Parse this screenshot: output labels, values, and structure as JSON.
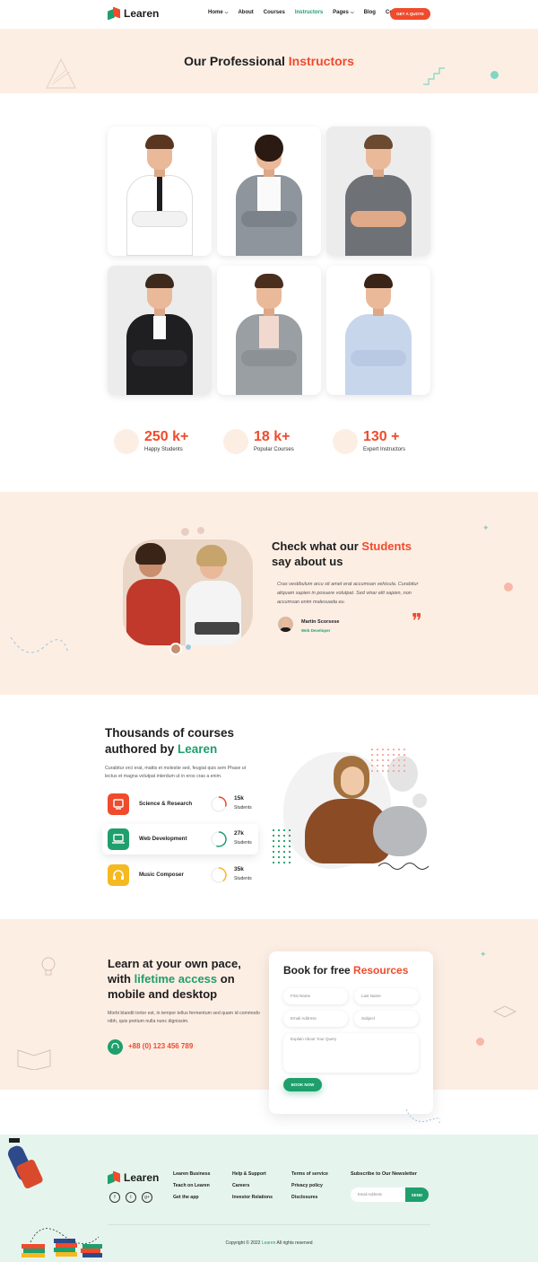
{
  "header": {
    "logo_text": "Learen",
    "nav": [
      {
        "label": "Home",
        "has_dropdown": true,
        "active": false
      },
      {
        "label": "About",
        "has_dropdown": false,
        "active": false
      },
      {
        "label": "Courses",
        "has_dropdown": false,
        "active": false
      },
      {
        "label": "Instructors",
        "has_dropdown": false,
        "active": true
      },
      {
        "label": "Pages",
        "has_dropdown": true,
        "active": false
      },
      {
        "label": "Blog",
        "has_dropdown": false,
        "active": false
      },
      {
        "label": "Contact",
        "has_dropdown": false,
        "active": false
      }
    ],
    "cta_label": "GET A QUOTE"
  },
  "hero": {
    "title_plain": "Our Professional",
    "title_accent": "Instructors"
  },
  "instructors": [
    {
      "name": "instructor-1",
      "icon": "person-photo"
    },
    {
      "name": "instructor-2",
      "icon": "person-photo"
    },
    {
      "name": "instructor-3",
      "icon": "person-photo"
    },
    {
      "name": "instructor-4",
      "icon": "person-photo"
    },
    {
      "name": "instructor-5",
      "icon": "person-photo"
    },
    {
      "name": "instructor-6",
      "icon": "person-photo"
    }
  ],
  "stats": [
    {
      "value": "250 k+",
      "label": "Happy Students",
      "icon": "student-icon"
    },
    {
      "value": "18 k+",
      "label": "Popular Courses",
      "icon": "courses-icon"
    },
    {
      "value": "130 +",
      "label": "Expert Instructors",
      "icon": "instructor-icon"
    }
  ],
  "testimonial": {
    "title_line1_plain": "Check what our",
    "title_line1_accent": "Students",
    "title_line2": "say about us",
    "quote": "Cras vestibulum arcu sit amet erat accumsan vehicula. Curabitur aliquam sapien in posuere volutpat. Sed vinar elit sapien, non accumsan enim malesuada eu.",
    "author_name": "Martin Scorsese",
    "author_role": "Web Developer"
  },
  "courses": {
    "title_line1": "Thousands of courses",
    "title_line2_plain": "authored by",
    "title_line2_accent": "Learen",
    "description": "Curabitur orci erat, mattis et molestie sed, feugiat quis sem Phase ut lectus et magna volutpat interdum ut in eros cras a enim.",
    "items": [
      {
        "name": "Science & Research",
        "count": "15k",
        "unit": "Students",
        "color": "#ef4b2c",
        "progress": 0.3
      },
      {
        "name": "Web Development",
        "count": "27k",
        "unit": "Students",
        "color": "#1e9f6c",
        "progress": 0.55
      },
      {
        "name": "Music Composer",
        "count": "35k",
        "unit": "Students",
        "color": "#f5b921",
        "progress": 0.4
      }
    ]
  },
  "book": {
    "title_line1": "Learn at your own pace,",
    "title_line2_plain": "with",
    "title_line2_accent": "lifetime access",
    "title_line2_end": "on",
    "title_line3": "mobile and desktop",
    "description": "Morbi blandit tortor est, in tempor tellus fermentum sed quam id commodo nibh, quis pretium nulla nunc dignissim.",
    "phone": "+88 (0) 123 456 789",
    "form_title_plain": "Book for free",
    "form_title_accent": "Resources",
    "first_name_placeholder": "First Name",
    "last_name_placeholder": "Last Name",
    "email_placeholder": "Email Address",
    "subject_placeholder": "Subject",
    "message_placeholder": "Explain About Your Query",
    "button_label": "BOOK NOW"
  },
  "footer": {
    "logo_text": "Learen",
    "social": [
      "f",
      "t",
      "g+"
    ],
    "col1": [
      "Learen Business",
      "Teach on Learen",
      "Get the app"
    ],
    "col2": [
      "Help & Support",
      "Careers",
      "Investor Relations"
    ],
    "col3": [
      "Terms of service",
      "Privacy policy",
      "Disclosures"
    ],
    "newsletter_title": "Subscribe to Our Newsletter",
    "newsletter_placeholder": "Email Address",
    "newsletter_button": "SEND",
    "copyright_plain": "Copyright © 2022",
    "copyright_accent": "Learen",
    "copyright_end": "All rights reserved"
  },
  "colors": {
    "accent_red": "#ef4b2c",
    "accent_green": "#1e9f6c",
    "peach_bg": "#fdeee4",
    "mint_bg": "#e6f4ee"
  }
}
